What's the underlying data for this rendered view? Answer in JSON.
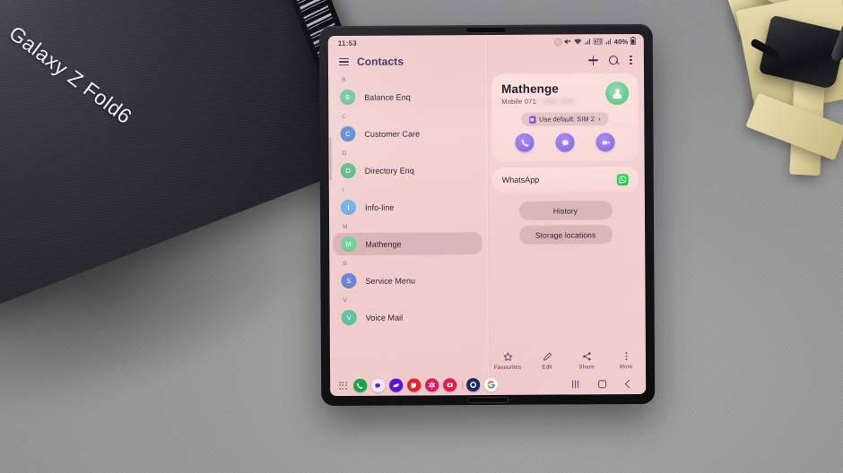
{
  "scene": {
    "box_title": "Galaxy Z Fold6",
    "objects": [
      "samsung-phone-box",
      "wooden-clamp-stand",
      "desk-surface"
    ]
  },
  "status_bar": {
    "time": "11:53",
    "icons": [
      "mute-icon",
      "wifi-icon",
      "signal-sim1-icon",
      "network-icon",
      "signal-sim2-icon"
    ],
    "battery_percent": "40%"
  },
  "app_bar": {
    "title": "Contacts",
    "menu_icon": "hamburger-icon",
    "add_icon": "plus-icon",
    "search_icon": "search-icon",
    "more_icon": "kebab-icon"
  },
  "contact_list": {
    "sections": [
      {
        "letter": "B",
        "contacts": [
          {
            "initial": "B",
            "name": "Balance Enq",
            "color": "#6fc795",
            "selected": false
          }
        ]
      },
      {
        "letter": "C",
        "contacts": [
          {
            "initial": "C",
            "name": "Customer Care",
            "color": "#5f8fd8",
            "selected": false
          }
        ]
      },
      {
        "letter": "D",
        "contacts": [
          {
            "initial": "D",
            "name": "Directory Enq",
            "color": "#62bd8e",
            "selected": false
          }
        ]
      },
      {
        "letter": "I",
        "contacts": [
          {
            "initial": "I",
            "name": "Info-line",
            "color": "#76b3e6",
            "selected": false
          }
        ]
      },
      {
        "letter": "M",
        "contacts": [
          {
            "initial": "M",
            "name": "Mathenge",
            "color": "#70d49b",
            "selected": true
          }
        ]
      },
      {
        "letter": "S",
        "contacts": [
          {
            "initial": "S",
            "name": "Service Menu",
            "color": "#7184d8",
            "selected": false
          }
        ]
      },
      {
        "letter": "V",
        "contacts": [
          {
            "initial": "V",
            "name": "Voice Mail",
            "color": "#5fc4a2",
            "selected": false
          }
        ]
      }
    ]
  },
  "detail": {
    "name": "Mathenge",
    "mobile_label": "Mobile",
    "mobile_number": "071",
    "mobile_number_masked": "7 888 888",
    "avatar_icon": "person-icon",
    "sim_chip": {
      "icon": "sim-card-icon",
      "label": "Use default: SIM 2",
      "chevron": "›"
    },
    "actions": [
      {
        "name": "call-button",
        "icon": "phone-icon"
      },
      {
        "name": "message-button",
        "icon": "message-bubble-icon"
      },
      {
        "name": "video-call-button",
        "icon": "video-camera-icon"
      }
    ],
    "whatsapp_row": {
      "label": "WhatsApp",
      "icon": "whatsapp-icon"
    },
    "pills": [
      {
        "label": "History"
      },
      {
        "label": "Storage locations"
      }
    ]
  },
  "toolbar": [
    {
      "label": "Favourites",
      "icon": "star-icon"
    },
    {
      "label": "Edit",
      "icon": "pencil-icon"
    },
    {
      "label": "Share",
      "icon": "share-icon"
    },
    {
      "label": "More",
      "icon": "kebab-icon"
    }
  ],
  "dock": {
    "apps_icon": "app-drawer-icon",
    "items": [
      {
        "name": "phone-app-icon",
        "color": "#1aa34a",
        "glyph_color": "#ffffff"
      },
      {
        "name": "messages-app-icon",
        "color": "#f2e4f5",
        "glyph_color": "#3b2fd6"
      },
      {
        "name": "samsung-internet-app-icon",
        "color": "#5a15d6",
        "glyph_color": "#ffffff"
      },
      {
        "name": "notes-app-icon",
        "color": "#e8202a",
        "glyph_color": "#ffffff"
      },
      {
        "name": "gallery-app-icon",
        "color": "#d81b5c",
        "glyph_color": "#ffffff"
      },
      {
        "name": "camera-app-icon",
        "color": "#e01b4c",
        "glyph_color": "#ffffff"
      },
      {
        "name": "settings-app-icon",
        "color": "#1b2a66",
        "glyph_color": "#ffffff"
      },
      {
        "name": "google-app-icon",
        "color": "#ffffff",
        "glyph_color": "#4285f4"
      }
    ],
    "nav_keys": [
      "recents-key",
      "home-key",
      "back-key"
    ]
  },
  "colors": {
    "screen_bg": "#efcbcb",
    "accent_purple": "#8f72e6",
    "title_purple": "#3c2e63",
    "card_bg": "#fde2e0"
  }
}
